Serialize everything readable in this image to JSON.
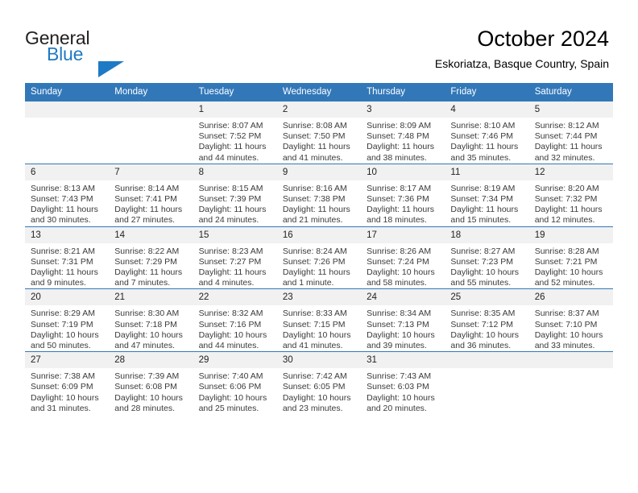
{
  "brand": {
    "name_part1": "General",
    "name_part2": "Blue",
    "triangle_color": "#1e7ac4"
  },
  "header": {
    "title": "October 2024",
    "subtitle": "Eskoriatza, Basque Country, Spain",
    "accent_color": "#3278b9"
  },
  "calendar": {
    "weekday_headers": [
      "Sunday",
      "Monday",
      "Tuesday",
      "Wednesday",
      "Thursday",
      "Friday",
      "Saturday"
    ],
    "weeks": [
      [
        {
          "day": "",
          "empty": true
        },
        {
          "day": "",
          "empty": true
        },
        {
          "day": "1",
          "sunrise": "Sunrise: 8:07 AM",
          "sunset": "Sunset: 7:52 PM",
          "daylight": "Daylight: 11 hours and 44 minutes."
        },
        {
          "day": "2",
          "sunrise": "Sunrise: 8:08 AM",
          "sunset": "Sunset: 7:50 PM",
          "daylight": "Daylight: 11 hours and 41 minutes."
        },
        {
          "day": "3",
          "sunrise": "Sunrise: 8:09 AM",
          "sunset": "Sunset: 7:48 PM",
          "daylight": "Daylight: 11 hours and 38 minutes."
        },
        {
          "day": "4",
          "sunrise": "Sunrise: 8:10 AM",
          "sunset": "Sunset: 7:46 PM",
          "daylight": "Daylight: 11 hours and 35 minutes."
        },
        {
          "day": "5",
          "sunrise": "Sunrise: 8:12 AM",
          "sunset": "Sunset: 7:44 PM",
          "daylight": "Daylight: 11 hours and 32 minutes."
        }
      ],
      [
        {
          "day": "6",
          "sunrise": "Sunrise: 8:13 AM",
          "sunset": "Sunset: 7:43 PM",
          "daylight": "Daylight: 11 hours and 30 minutes."
        },
        {
          "day": "7",
          "sunrise": "Sunrise: 8:14 AM",
          "sunset": "Sunset: 7:41 PM",
          "daylight": "Daylight: 11 hours and 27 minutes."
        },
        {
          "day": "8",
          "sunrise": "Sunrise: 8:15 AM",
          "sunset": "Sunset: 7:39 PM",
          "daylight": "Daylight: 11 hours and 24 minutes."
        },
        {
          "day": "9",
          "sunrise": "Sunrise: 8:16 AM",
          "sunset": "Sunset: 7:38 PM",
          "daylight": "Daylight: 11 hours and 21 minutes."
        },
        {
          "day": "10",
          "sunrise": "Sunrise: 8:17 AM",
          "sunset": "Sunset: 7:36 PM",
          "daylight": "Daylight: 11 hours and 18 minutes."
        },
        {
          "day": "11",
          "sunrise": "Sunrise: 8:19 AM",
          "sunset": "Sunset: 7:34 PM",
          "daylight": "Daylight: 11 hours and 15 minutes."
        },
        {
          "day": "12",
          "sunrise": "Sunrise: 8:20 AM",
          "sunset": "Sunset: 7:32 PM",
          "daylight": "Daylight: 11 hours and 12 minutes."
        }
      ],
      [
        {
          "day": "13",
          "sunrise": "Sunrise: 8:21 AM",
          "sunset": "Sunset: 7:31 PM",
          "daylight": "Daylight: 11 hours and 9 minutes."
        },
        {
          "day": "14",
          "sunrise": "Sunrise: 8:22 AM",
          "sunset": "Sunset: 7:29 PM",
          "daylight": "Daylight: 11 hours and 7 minutes."
        },
        {
          "day": "15",
          "sunrise": "Sunrise: 8:23 AM",
          "sunset": "Sunset: 7:27 PM",
          "daylight": "Daylight: 11 hours and 4 minutes."
        },
        {
          "day": "16",
          "sunrise": "Sunrise: 8:24 AM",
          "sunset": "Sunset: 7:26 PM",
          "daylight": "Daylight: 11 hours and 1 minute."
        },
        {
          "day": "17",
          "sunrise": "Sunrise: 8:26 AM",
          "sunset": "Sunset: 7:24 PM",
          "daylight": "Daylight: 10 hours and 58 minutes."
        },
        {
          "day": "18",
          "sunrise": "Sunrise: 8:27 AM",
          "sunset": "Sunset: 7:23 PM",
          "daylight": "Daylight: 10 hours and 55 minutes."
        },
        {
          "day": "19",
          "sunrise": "Sunrise: 8:28 AM",
          "sunset": "Sunset: 7:21 PM",
          "daylight": "Daylight: 10 hours and 52 minutes."
        }
      ],
      [
        {
          "day": "20",
          "sunrise": "Sunrise: 8:29 AM",
          "sunset": "Sunset: 7:19 PM",
          "daylight": "Daylight: 10 hours and 50 minutes."
        },
        {
          "day": "21",
          "sunrise": "Sunrise: 8:30 AM",
          "sunset": "Sunset: 7:18 PM",
          "daylight": "Daylight: 10 hours and 47 minutes."
        },
        {
          "day": "22",
          "sunrise": "Sunrise: 8:32 AM",
          "sunset": "Sunset: 7:16 PM",
          "daylight": "Daylight: 10 hours and 44 minutes."
        },
        {
          "day": "23",
          "sunrise": "Sunrise: 8:33 AM",
          "sunset": "Sunset: 7:15 PM",
          "daylight": "Daylight: 10 hours and 41 minutes."
        },
        {
          "day": "24",
          "sunrise": "Sunrise: 8:34 AM",
          "sunset": "Sunset: 7:13 PM",
          "daylight": "Daylight: 10 hours and 39 minutes."
        },
        {
          "day": "25",
          "sunrise": "Sunrise: 8:35 AM",
          "sunset": "Sunset: 7:12 PM",
          "daylight": "Daylight: 10 hours and 36 minutes."
        },
        {
          "day": "26",
          "sunrise": "Sunrise: 8:37 AM",
          "sunset": "Sunset: 7:10 PM",
          "daylight": "Daylight: 10 hours and 33 minutes."
        }
      ],
      [
        {
          "day": "27",
          "sunrise": "Sunrise: 7:38 AM",
          "sunset": "Sunset: 6:09 PM",
          "daylight": "Daylight: 10 hours and 31 minutes."
        },
        {
          "day": "28",
          "sunrise": "Sunrise: 7:39 AM",
          "sunset": "Sunset: 6:08 PM",
          "daylight": "Daylight: 10 hours and 28 minutes."
        },
        {
          "day": "29",
          "sunrise": "Sunrise: 7:40 AM",
          "sunset": "Sunset: 6:06 PM",
          "daylight": "Daylight: 10 hours and 25 minutes."
        },
        {
          "day": "30",
          "sunrise": "Sunrise: 7:42 AM",
          "sunset": "Sunset: 6:05 PM",
          "daylight": "Daylight: 10 hours and 23 minutes."
        },
        {
          "day": "31",
          "sunrise": "Sunrise: 7:43 AM",
          "sunset": "Sunset: 6:03 PM",
          "daylight": "Daylight: 10 hours and 20 minutes."
        },
        {
          "day": "",
          "empty": true
        },
        {
          "day": "",
          "empty": true
        }
      ]
    ]
  }
}
